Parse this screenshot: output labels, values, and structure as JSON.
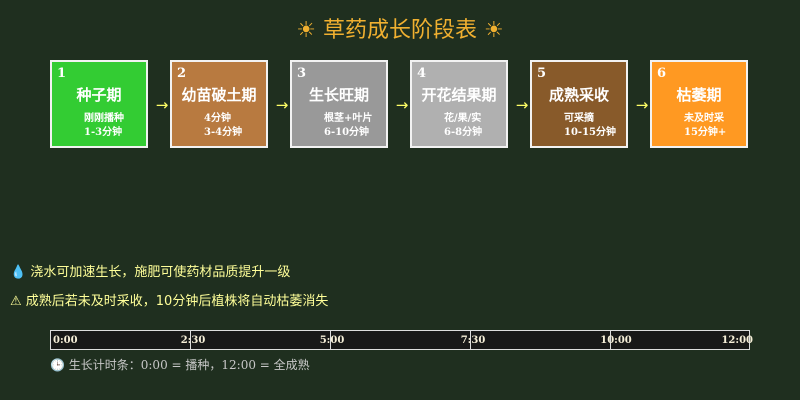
{
  "header": {
    "sun_left": "☀",
    "title": "草药成长阶段表",
    "sun_right": "☀"
  },
  "stages": [
    {
      "num": "1",
      "name": "种子期",
      "line1": "刚刚播种",
      "line2": "1-3分钟",
      "color": "#33cc33"
    },
    {
      "num": "2",
      "name": "幼苗破土期",
      "line1": "4分钟",
      "line2": "3-4分钟",
      "color": "#b87a40"
    },
    {
      "num": "3",
      "name": "生长旺期",
      "line1": "根茎+叶片",
      "line2": "6-10分钟",
      "color": "#999999"
    },
    {
      "num": "4",
      "name": "开花结果期",
      "line1": "花/果/实",
      "line2": "6-8分钟",
      "color": "#b0b0b0"
    },
    {
      "num": "5",
      "name": "成熟采收",
      "line1": "可采摘",
      "line2": "10-15分钟",
      "color": "#885a2a"
    },
    {
      "num": "6",
      "name": "枯萎期",
      "line1": "未及时采",
      "line2": "15分钟+",
      "color": "#ff9922"
    }
  ],
  "arrow_glyph": "→",
  "notes": {
    "note1": "💧 浇水可加速生长，施肥可使药材品质提升一级",
    "note2": "⚠ 成熟后若未及时采收，10分钟后植株将自动枯萎消失"
  },
  "timeline": {
    "ticks": [
      "0:00",
      "2:30",
      "5:00",
      "7:30",
      "10:00",
      "12:00"
    ],
    "legend": "🕒 生长计时条：0:00 = 播种，12:00 = 全成熟"
  }
}
